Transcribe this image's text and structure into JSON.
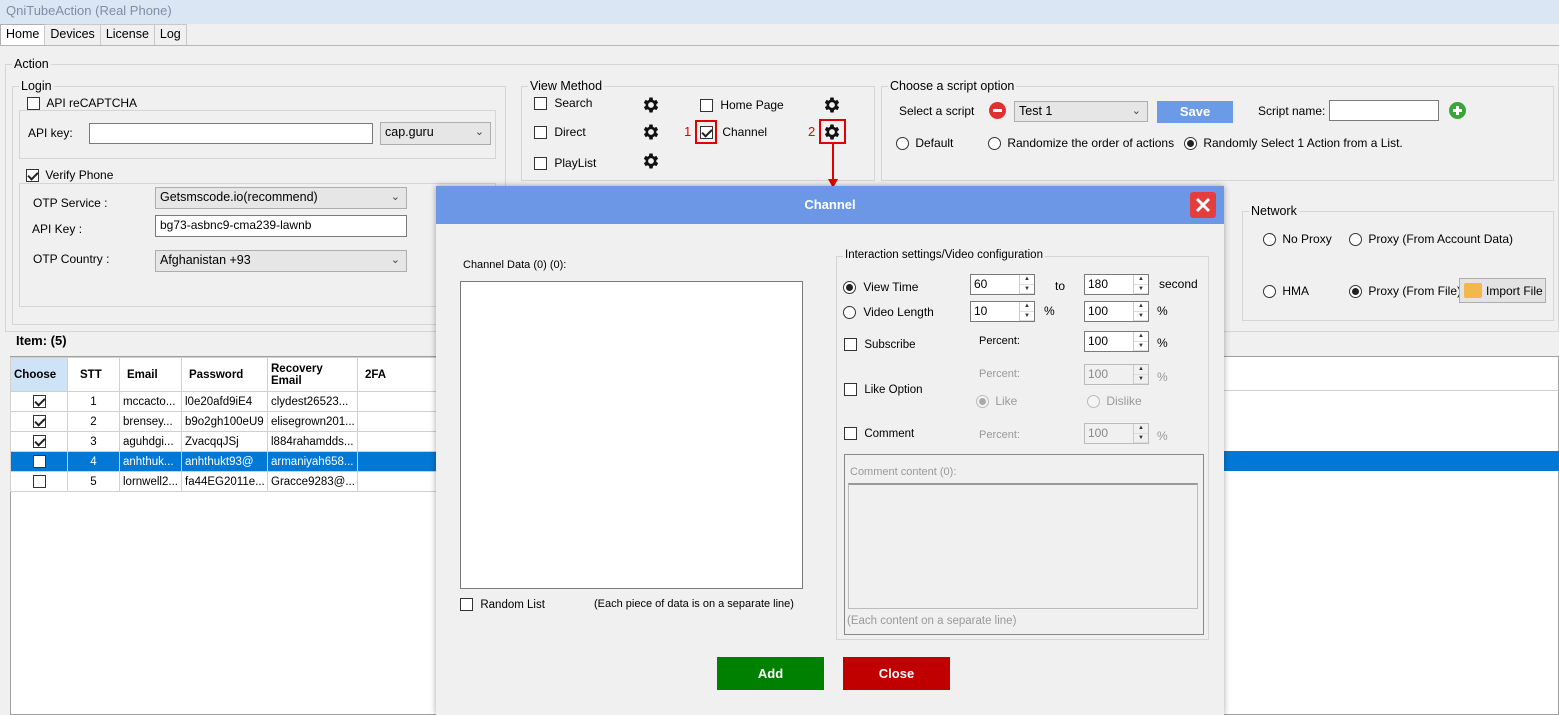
{
  "window": {
    "title": "QniTubeAction (Real Phone)"
  },
  "tabs": [
    "Home",
    "Devices",
    "License",
    "Log"
  ],
  "action": {
    "label": "Action",
    "login": {
      "label": "Login",
      "recaptcha": {
        "label": "API reCAPTCHA",
        "checked": false,
        "api_key_label": "API key:",
        "api_key_value": "",
        "provider": "cap.guru"
      },
      "verify_phone": {
        "label": "Verify Phone",
        "checked": true,
        "otp_service_label": "OTP Service :",
        "otp_service": "Getsmscode.io(recommend)",
        "api_key_label": "API Key :",
        "api_key": "bg73-asbnc9-cma239-lawnb",
        "otp_country_label": "OTP Country :",
        "otp_country": "Afghanistan +93"
      }
    },
    "view_method": {
      "label": "View Method",
      "items": [
        {
          "label": "Search",
          "checked": false
        },
        {
          "label": "Direct",
          "checked": false
        },
        {
          "label": "PlayList",
          "checked": false
        },
        {
          "label": "Home Page",
          "checked": false
        },
        {
          "label": "Channel",
          "checked": true
        }
      ],
      "marker_1": "1",
      "marker_2": "2"
    },
    "script_option": {
      "label": "Choose a script option",
      "select_label": "Select a script",
      "selected_script": "Test 1",
      "save_label": "Save",
      "name_label": "Script name:",
      "name_value": "",
      "modes": [
        {
          "label": "Default",
          "checked": false
        },
        {
          "label": "Randomize the order of actions",
          "checked": false
        },
        {
          "label": "Randomly Select 1 Action from a List.",
          "checked": true
        }
      ]
    },
    "network": {
      "label": "Network",
      "options": [
        {
          "label": "No Proxy",
          "checked": false
        },
        {
          "label": "Proxy (From Account Data)",
          "checked": false
        },
        {
          "label": "HMA",
          "checked": false
        },
        {
          "label": "Proxy (From File)",
          "checked": true
        }
      ],
      "import_label": "Import File"
    }
  },
  "items": {
    "label": "Item: (5)",
    "columns": [
      "Choose",
      "STT",
      "Email",
      "Password",
      "Recovery Email",
      "2FA"
    ],
    "rows": [
      {
        "checked": true,
        "stt": "1",
        "email": "mccacto...",
        "password": "l0e20afd9iE4",
        "recovery": "clydest26523...",
        "twofa": ""
      },
      {
        "checked": true,
        "stt": "2",
        "email": "brensey...",
        "password": "b9o2gh100eU9",
        "recovery": "elisegrown201...",
        "twofa": ""
      },
      {
        "checked": true,
        "stt": "3",
        "email": "aguhdgi...",
        "password": "ZvacqqJSj",
        "recovery": "l884rahamdds...",
        "twofa": ""
      },
      {
        "checked": false,
        "stt": "4",
        "email": "anhthuk...",
        "password": "anhthukt93@",
        "recovery": "armaniyah658...",
        "twofa": "",
        "selected": true
      },
      {
        "checked": false,
        "stt": "5",
        "email": "lornwell2...",
        "password": "fa44EG2011e...",
        "recovery": "Gracce9283@...",
        "twofa": ""
      }
    ]
  },
  "dialog": {
    "title": "Channel",
    "channel_data_label": "Channel Data (0) (0):",
    "channel_data_value": "",
    "random_list_label": "Random List",
    "random_list_checked": false,
    "separate_line_note": "(Each piece of data is on a separate line)",
    "interaction": {
      "label": "Interaction settings/Video configuration",
      "view_time": {
        "label": "View Time",
        "checked": true,
        "from": "60",
        "to_label": "to",
        "to": "180",
        "unit": "second"
      },
      "video_length": {
        "label": "Video Length",
        "checked": false,
        "from": "10",
        "from_unit": "%",
        "to": "100",
        "to_unit": "%"
      },
      "subscribe": {
        "label": "Subscribe",
        "checked": false,
        "percent_label": "Percent:",
        "percent": "100",
        "unit": "%"
      },
      "like": {
        "label": "Like Option",
        "checked": false,
        "percent_label": "Percent:",
        "percent": "100",
        "unit": "%",
        "like_label": "Like",
        "dislike_label": "Dislike"
      },
      "comment": {
        "label": "Comment",
        "checked": false,
        "percent_label": "Percent:",
        "percent": "100",
        "unit": "%"
      },
      "comment_content_label": "Comment content (0):",
      "comment_note": "(Each content on a separate line)"
    },
    "add_label": "Add",
    "close_label": "Close"
  },
  "colors": {
    "dialog_header": "#6b97e6",
    "add_button": "#008000",
    "close_button": "#c00000",
    "save_button": "#6b9be6",
    "selected_row": "#0078d7",
    "annotation": "#e10000"
  }
}
